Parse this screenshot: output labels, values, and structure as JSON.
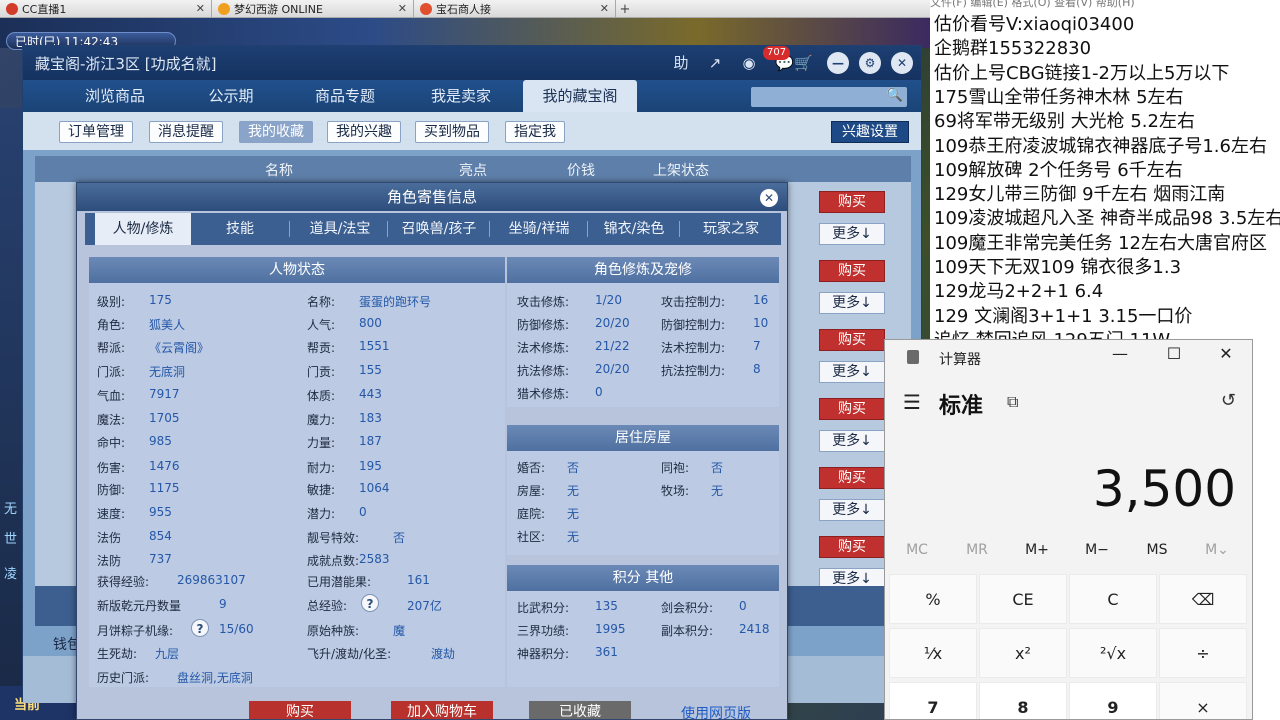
{
  "browser_tabs": [
    {
      "label": "CC直播1"
    },
    {
      "label": "梦幻西游 ONLINE"
    },
    {
      "label": "宝石商人接"
    }
  ],
  "game": {
    "clock": "已时(巳)  11:42:43",
    "left_badges": [
      "无",
      "世",
      "凌"
    ],
    "current_label": "当前"
  },
  "cbg": {
    "title": "藏宝阁-浙江3区 [功成名就]",
    "help_label": "助",
    "cart_count": "707",
    "nav": [
      "浏览商品",
      "公示期",
      "商品专题",
      "我是卖家",
      "我的藏宝阁"
    ],
    "subnav": [
      "订单管理",
      "消息提醒",
      "我的收藏",
      "我的兴趣",
      "买到物品",
      "指定我"
    ],
    "interest_settings": "兴趣设置",
    "columns": [
      "名称",
      "亮点",
      "价钱",
      "上架状态"
    ],
    "buy_label": "购买",
    "more_label": "更多↓",
    "wallet_label": "钱包"
  },
  "dialog": {
    "title": "角色寄售信息",
    "tabs": [
      "人物/修炼",
      "技能",
      "道具/法宝",
      "召唤兽/孩子",
      "坐骑/祥瑞",
      "锦衣/染色",
      "玩家之家"
    ],
    "status_head": "人物状态",
    "status_left": [
      {
        "label": "级别:",
        "value": "175"
      },
      {
        "label": "角色:",
        "value": "狐美人"
      },
      {
        "label": "帮派:",
        "value": "《云霄阁》"
      },
      {
        "label": "门派:",
        "value": "无底洞"
      },
      {
        "label": "气血:",
        "value": "7917"
      },
      {
        "label": "魔法:",
        "value": "1705"
      },
      {
        "label": "命中:",
        "value": "985"
      },
      {
        "label": "伤害:",
        "value": "1476"
      },
      {
        "label": "防御:",
        "value": "1175"
      },
      {
        "label": "速度:",
        "value": "955"
      },
      {
        "label": "法伤",
        "value": "854"
      },
      {
        "label": "法防",
        "value": "737"
      }
    ],
    "status_right": [
      {
        "label": "名称:",
        "value": "蛋蛋的跑环号"
      },
      {
        "label": "人气:",
        "value": "800"
      },
      {
        "label": "帮贡:",
        "value": "1551"
      },
      {
        "label": "门贡:",
        "value": "155"
      },
      {
        "label": "体质:",
        "value": "443"
      },
      {
        "label": "魔力:",
        "value": "183"
      },
      {
        "label": "力量:",
        "value": "187"
      },
      {
        "label": "耐力:",
        "value": "195"
      },
      {
        "label": "敏捷:",
        "value": "1064"
      },
      {
        "label": "潜力:",
        "value": "0"
      },
      {
        "label": "靓号特效:",
        "value": "否"
      },
      {
        "label": "成就点数:",
        "value": "2583"
      }
    ],
    "exp_label": "获得经验:",
    "exp_value": "269863107",
    "potential_label": "已用潜能果:",
    "potential_value": "161",
    "qianyuan_label": "新版乾元丹数量",
    "qianyuan_value": "9",
    "total_exp_label": "总经验:",
    "total_exp_value": "207亿",
    "mooncake_label": "月饼粽子机缘:",
    "mooncake_value": "15/60",
    "origin_label": "原始种族:",
    "origin_value": "魔",
    "life_label": "生死劫:",
    "life_value": "九层",
    "fly_label": "飞升/渡劫/化圣:",
    "fly_value": "渡劫",
    "history_label": "历史门派:",
    "history_value": "盘丝洞,无底洞",
    "cultivation_head": "角色修炼及宠修",
    "cultivation": [
      {
        "l1": "攻击修炼:",
        "v1": "1/20",
        "l2": "攻击控制力:",
        "v2": "16"
      },
      {
        "l1": "防御修炼:",
        "v1": "20/20",
        "l2": "防御控制力:",
        "v2": "10"
      },
      {
        "l1": "法术修炼:",
        "v1": "21/22",
        "l2": "法术控制力:",
        "v2": "7"
      },
      {
        "l1": "抗法修炼:",
        "v1": "20/20",
        "l2": "抗法控制力:",
        "v2": "8"
      },
      {
        "l1": "猎术修炼:",
        "v1": "0",
        "l2": "",
        "v2": ""
      }
    ],
    "house_head": "居住房屋",
    "house": [
      {
        "l1": "婚否:",
        "v1": "否",
        "l2": "同袍:",
        "v2": "否"
      },
      {
        "l1": "房屋:",
        "v1": "无",
        "l2": "牧场:",
        "v2": "无"
      },
      {
        "l1": "庭院:",
        "v1": "无",
        "l2": "",
        "v2": ""
      },
      {
        "l1": "社区:",
        "v1": "无",
        "l2": "",
        "v2": ""
      }
    ],
    "score_head": "积分 其他",
    "score": [
      {
        "l1": "比武积分:",
        "v1": "135",
        "l2": "剑会积分:",
        "v2": "0"
      },
      {
        "l1": "三界功绩:",
        "v1": "1995",
        "l2": "副本积分:",
        "v2": "2418"
      },
      {
        "l1": "神器积分:",
        "v1": "361",
        "l2": "",
        "v2": ""
      }
    ],
    "buttons": [
      "购买",
      "加入购物车",
      "已收藏"
    ],
    "web_link": "使用网页版"
  },
  "notes": {
    "top_menu": "文件(F)   编辑(E)   格式(O)   查看(V)   帮助(H)",
    "lines": [
      "估价看号V:xiaoqi03400",
      "企鹅群155322830",
      "估价上号CBG链接1-2万以上5万以下",
      "175雪山全带任务神木林 5左右",
      "69将军带无级别 大光枪 5.2左右",
      "109恭王府凌波城锦衣神器底子号1.6左右",
      "109解放碑 2个任务号 6千左右",
      "129女儿带三防御 9千左右 烟雨江南",
      "109凌波城超凡入圣 神奇半成品98 3.5左右",
      "109魔王非常完美任务 12左右大唐官府区",
      "109天下无双109  锦衣很多1.3",
      "129龙马2+2+1  6.4",
      "129 文澜阁3+1+1   3.15一口价",
      "追忆 梦回追风 129五门 11W"
    ]
  },
  "calculator": {
    "app_name": "计算器",
    "mode": "标准",
    "display": "3,500",
    "memory": [
      "MC",
      "MR",
      "M+",
      "M−",
      "MS",
      "M⌄"
    ],
    "keys_row1": [
      "%",
      "CE",
      "C",
      "⌫"
    ],
    "keys_row2": [
      "¹⁄x",
      "x²",
      "²√x",
      "÷"
    ],
    "keys_row3": [
      "7",
      "8",
      "9",
      "×"
    ]
  }
}
